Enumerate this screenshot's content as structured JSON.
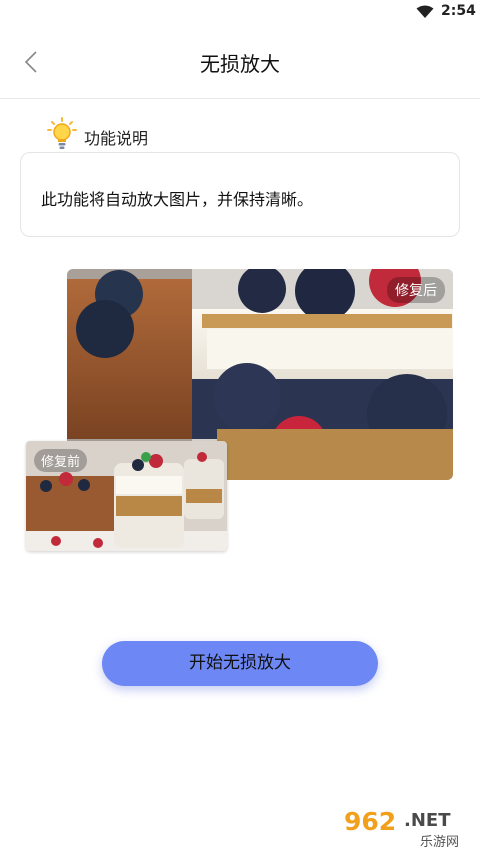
{
  "status_bar": {
    "time": "2:54"
  },
  "header": {
    "title": "无损放大"
  },
  "section": {
    "title": "功能说明",
    "description": "此功能将自动放大图片，并保持清晰。"
  },
  "images": {
    "after_label": "修复后",
    "before_label": "修复前"
  },
  "actions": {
    "start_label": "开始无损放大"
  },
  "watermark": {
    "number": "962",
    "suffix": ".NET",
    "caption": "乐游网"
  }
}
